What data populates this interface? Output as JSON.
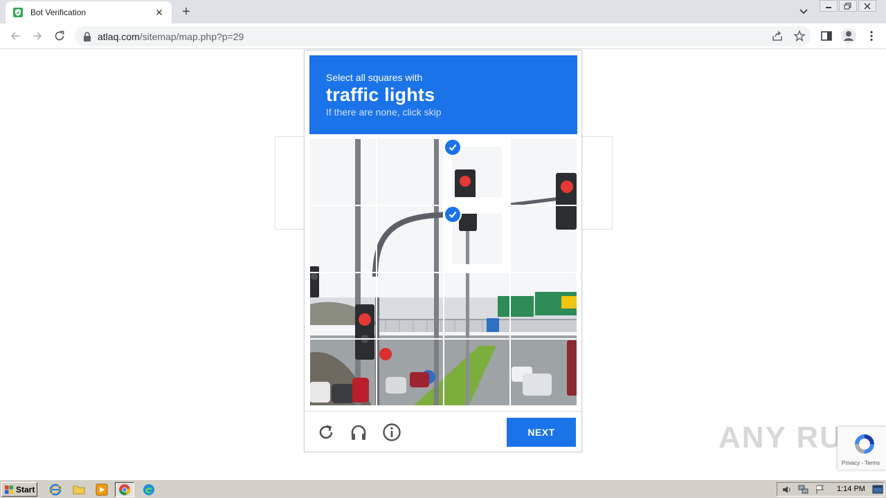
{
  "browser": {
    "tab_title": "Bot Verification",
    "url_host": "atlaq.com",
    "url_path": "/sitemap/map.php?p=29"
  },
  "captcha": {
    "instruction": "Select all squares with",
    "target": "traffic lights",
    "hint": "If there are none, click skip",
    "next_label": "NEXT",
    "selected_tiles": [
      2,
      6
    ],
    "colors": {
      "accent": "#1a73e8"
    }
  },
  "recaptcha_badge": {
    "links": "Privacy - Terms"
  },
  "watermark": "ANY RUN",
  "taskbar": {
    "start_label": "Start",
    "clock": "1:14 PM"
  }
}
